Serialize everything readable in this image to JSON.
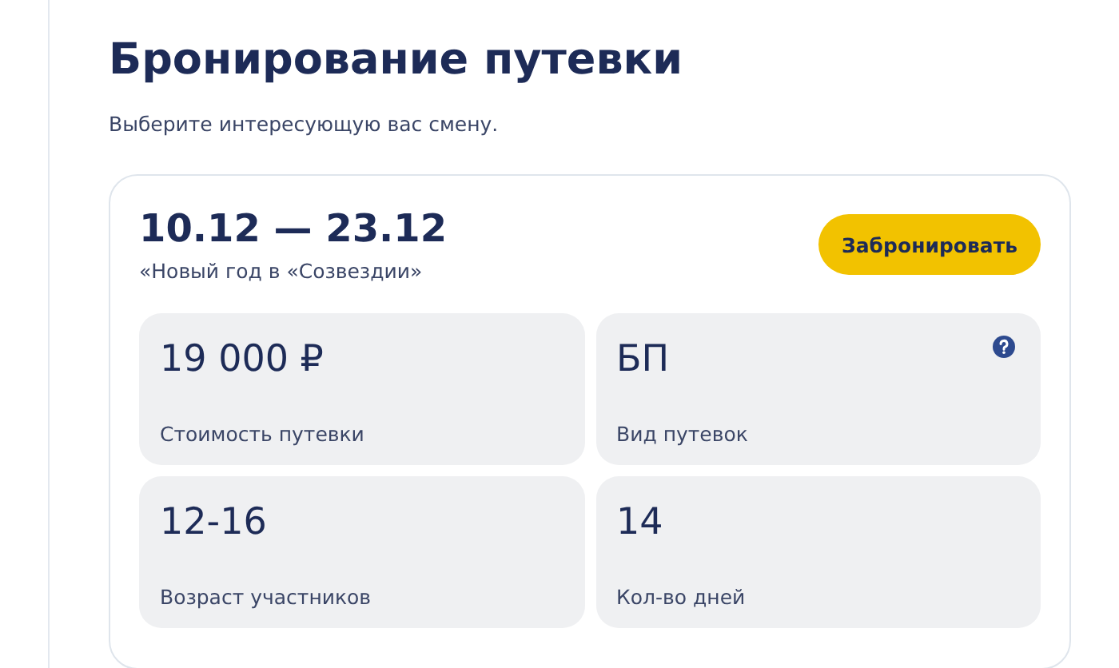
{
  "page": {
    "title": "Бронирование путевки",
    "subtitle": "Выберите интересующую вас смену."
  },
  "session": {
    "dates": "10.12 — 23.12",
    "name": "«Новый год в «Созвездии»",
    "book_button": "Забронировать",
    "facts": [
      {
        "value": "19 000 ₽",
        "label": "Стоимость путевки",
        "help": false
      },
      {
        "value": "БП",
        "label": "Вид путевок",
        "help": true
      },
      {
        "value": "12-16",
        "label": "Возраст участников",
        "help": false
      },
      {
        "value": "14",
        "label": "Кол-во дней",
        "help": false
      }
    ]
  }
}
